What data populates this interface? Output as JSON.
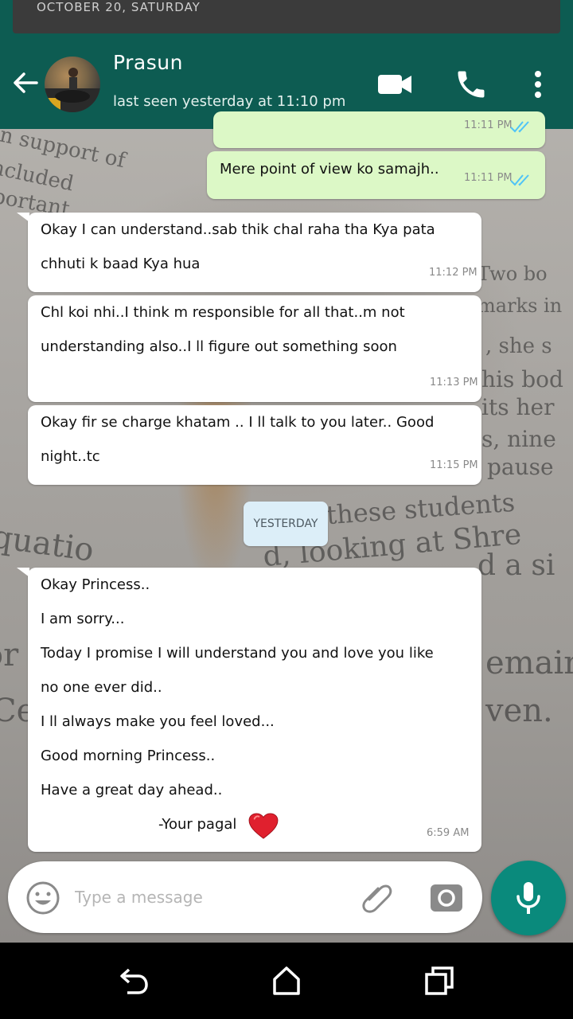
{
  "top_banner": {
    "date_text": "OCTOBER 20, SATURDAY"
  },
  "header": {
    "contact_name": "Prasun",
    "last_seen": "last seen yesterday at 11:10 pm",
    "icons": [
      "back-arrow-icon",
      "avatar",
      "video-call-icon",
      "voice-call-icon",
      "more-options-icon"
    ]
  },
  "messages": [
    {
      "direction": "out",
      "lines": [],
      "time": "11:11 PM",
      "status": "read"
    },
    {
      "direction": "out",
      "lines": [
        "Mere point of view ko samajh.."
      ],
      "time": "11:11 PM",
      "status": "read"
    },
    {
      "direction": "in",
      "lines": [
        "Okay I can understand..sab thik chal raha tha Kya pata",
        "chhuti k baad Kya hua"
      ],
      "time": "11:12 PM"
    },
    {
      "direction": "in",
      "lines": [
        "Chl koi nhi..I think m responsible for all that..m not",
        "understanding also..I ll figure out something soon"
      ],
      "time": "11:13 PM"
    },
    {
      "direction": "in",
      "lines": [
        "Okay fir se charge khatam .. I ll talk to you later.. Good",
        "night..tc"
      ],
      "time": "11:15 PM"
    }
  ],
  "date_separator": "YESTERDAY",
  "last_message": {
    "direction": "in",
    "lines": [
      "Okay Princess..",
      "I am sorry...",
      "Today I promise I will understand you and love you  like",
      "no one ever did..",
      "I ll always make you feel loved...",
      "Good morning Princess..",
      "Have a great day ahead.."
    ],
    "signature": "-Your pagal",
    "signature_emoji": "❤️",
    "time": "6:59 AM"
  },
  "composer": {
    "placeholder": "Type a message",
    "value": ""
  },
  "colors": {
    "header": "#0d5c52",
    "outgoing_bubble": "#dcf8c6",
    "incoming_bubble": "#ffffff",
    "mic_button": "#0a8a7c",
    "read_ticks": "#4fc3f7"
  }
}
